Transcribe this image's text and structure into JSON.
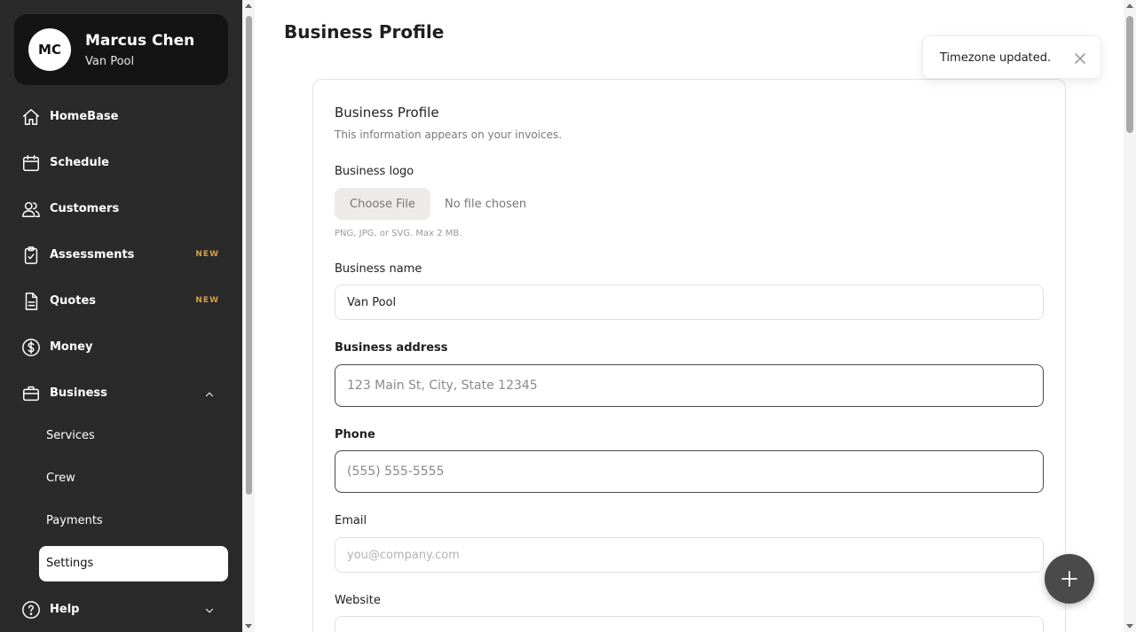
{
  "user": {
    "initials": "MC",
    "name": "Marcus Chen",
    "business": "Van Pool"
  },
  "nav": {
    "homebase": {
      "label": "HomeBase",
      "icon": "home-icon"
    },
    "schedule": {
      "label": "Schedule",
      "icon": "calendar-icon"
    },
    "customers": {
      "label": "Customers",
      "icon": "users-icon"
    },
    "assessments": {
      "label": "Assessments",
      "badge": "NEW",
      "icon": "clipboard-icon"
    },
    "quotes": {
      "label": "Quotes",
      "badge": "NEW",
      "icon": "document-icon"
    },
    "money": {
      "label": "Money",
      "icon": "dollar-icon"
    },
    "business": {
      "label": "Business",
      "icon": "briefcase-icon",
      "expanded": true,
      "children": {
        "services": "Services",
        "crew": "Crew",
        "payments": "Payments",
        "settings": "Settings"
      },
      "active_child": "Settings"
    },
    "help": {
      "label": "Help",
      "icon": "help-icon"
    }
  },
  "page": {
    "title": "Business Profile",
    "card": {
      "title": "Business Profile",
      "subtitle": "This information appears on your invoices.",
      "logo": {
        "label": "Business logo",
        "button": "Choose File",
        "status": "No file chosen",
        "hint": "PNG, JPG, or SVG. Max 2 MB."
      },
      "name": {
        "label": "Business name",
        "value": "Van Pool"
      },
      "address": {
        "label": "Business address",
        "placeholder": "123 Main St, City, State 12345"
      },
      "phone": {
        "label": "Phone",
        "placeholder": "(555) 555-5555"
      },
      "email": {
        "label": "Email",
        "placeholder": "you@company.com"
      },
      "website": {
        "label": "Website"
      }
    }
  },
  "toast": {
    "message": "Timezone updated."
  },
  "colors": {
    "sidebar": "#2a2a2b",
    "profile_card": "#141414",
    "badge": "#d9a23b",
    "fab": "#4a4a4a"
  }
}
